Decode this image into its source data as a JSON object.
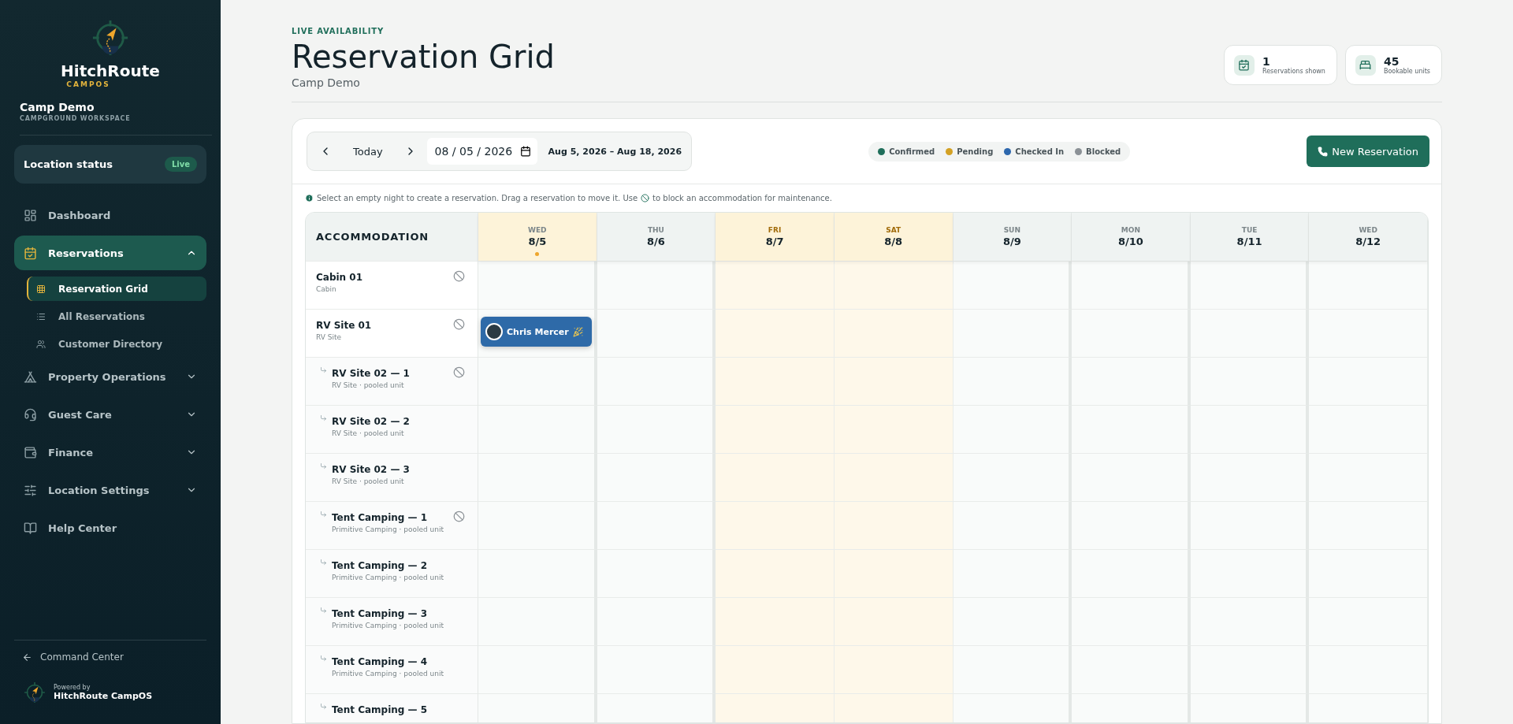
{
  "brand": {
    "name": "HitchRoute",
    "sub": "CAMPOS"
  },
  "workspace": {
    "name": "Camp Demo",
    "sub": "CAMPGROUND WORKSPACE"
  },
  "location_status": {
    "label": "Location status",
    "badge": "Live"
  },
  "nav": [
    {
      "label": "Dashboard",
      "selected": false
    },
    {
      "label": "Reservations",
      "selected": true,
      "expanded": true,
      "children": [
        {
          "label": "Reservation Grid",
          "selected": true
        },
        {
          "label": "All Reservations",
          "selected": false
        },
        {
          "label": "Customer Directory",
          "selected": false
        }
      ]
    },
    {
      "label": "Property Operations",
      "selected": false,
      "expanded": false
    },
    {
      "label": "Guest Care",
      "selected": false,
      "expanded": false
    },
    {
      "label": "Finance",
      "selected": false,
      "expanded": false
    },
    {
      "label": "Location Settings",
      "selected": false,
      "expanded": false
    },
    {
      "label": "Help Center",
      "selected": false
    }
  ],
  "back_link": "Command Center",
  "powered": {
    "label": "Powered by",
    "name": "HitchRoute CampOS"
  },
  "header": {
    "eyebrow": "LIVE AVAILABILITY",
    "title": "Reservation Grid",
    "subtitle": "Camp Demo"
  },
  "stats": [
    {
      "value": "1",
      "label": "Reservations shown"
    },
    {
      "value": "45",
      "label": "Bookable units"
    }
  ],
  "toolbar": {
    "today": "Today",
    "date": "08 / 05 / 2026",
    "range": "Aug 5, 2026 – Aug 18, 2026",
    "new_button": "New Reservation"
  },
  "legend": [
    {
      "label": "Confirmed",
      "color": "#1f6e5a"
    },
    {
      "label": "Pending",
      "color": "#d3a124"
    },
    {
      "label": "Checked In",
      "color": "#2d67ad"
    },
    {
      "label": "Blocked",
      "color": "#8b9196"
    }
  ],
  "hint": {
    "before": "Select an empty night to create a reservation. Drag a reservation to move it. Use",
    "after": "to block an accommodation for maintenance."
  },
  "grid": {
    "corner": "ACCOMMODATION",
    "days": [
      {
        "dow": "WED",
        "date": "8/5",
        "today": true,
        "weekend": false
      },
      {
        "dow": "THU",
        "date": "8/6",
        "today": false,
        "weekend": false
      },
      {
        "dow": "FRI",
        "date": "8/7",
        "today": false,
        "weekend": true
      },
      {
        "dow": "SAT",
        "date": "8/8",
        "today": false,
        "weekend": true
      },
      {
        "dow": "SUN",
        "date": "8/9",
        "today": false,
        "weekend": false
      },
      {
        "dow": "MON",
        "date": "8/10",
        "today": false,
        "weekend": false
      },
      {
        "dow": "TUE",
        "date": "8/11",
        "today": false,
        "weekend": false
      },
      {
        "dow": "WED",
        "date": "8/12",
        "today": false,
        "weekend": false
      }
    ],
    "rows": [
      {
        "name": "Cabin 01",
        "sub": "Cabin",
        "kind": "unit",
        "blockable": true
      },
      {
        "name": "RV Site 01",
        "sub": "RV Site",
        "kind": "unit",
        "blockable": true,
        "nights": [
          {
            "booked": true,
            "guest": "Chris Mercer"
          }
        ]
      },
      {
        "name": "RV Site 02 — 1",
        "sub": "RV Site · pooled unit",
        "kind": "pooled",
        "blockable": true
      },
      {
        "name": "RV Site 02 — 2",
        "sub": "RV Site · pooled unit",
        "kind": "pooled",
        "blockable": false
      },
      {
        "name": "RV Site 02 — 3",
        "sub": "RV Site · pooled unit",
        "kind": "pooled",
        "blockable": false
      },
      {
        "name": "Tent Camping — 1",
        "sub": "Primitive Camping · pooled unit",
        "kind": "pooled",
        "blockable": true
      },
      {
        "name": "Tent Camping — 2",
        "sub": "Primitive Camping · pooled unit",
        "kind": "pooled",
        "blockable": false
      },
      {
        "name": "Tent Camping — 3",
        "sub": "Primitive Camping · pooled unit",
        "kind": "pooled",
        "blockable": false
      },
      {
        "name": "Tent Camping — 4",
        "sub": "Primitive Camping · pooled unit",
        "kind": "pooled",
        "blockable": false
      },
      {
        "name": "Tent Camping — 5",
        "kind": "pooled",
        "blockable": false
      }
    ]
  }
}
